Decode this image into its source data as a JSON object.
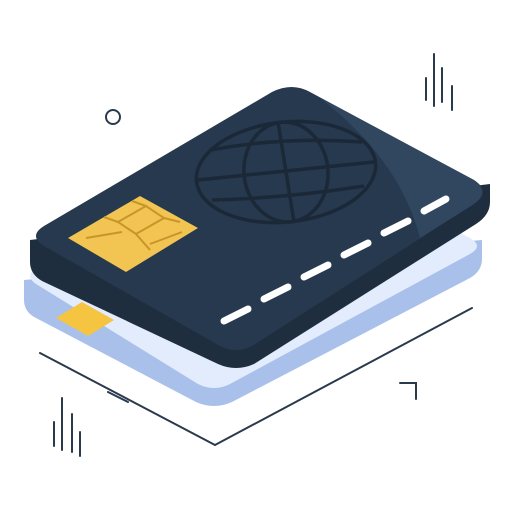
{
  "illustration": {
    "subject": "credit-card-stack",
    "card_count": 2,
    "colors": {
      "front_card_face": "#27394e",
      "front_card_side": "#1f2e3e",
      "front_card_highlight": "#344d66",
      "globe_stroke": "#1b2837",
      "chip": "#f2c452",
      "chip_lines": "#c8952a",
      "magstripe_dashes": "#ffffff",
      "back_card_face": "#e3ecfc",
      "back_card_side": "#a9c0ea",
      "back_card_strip": "#f5c542",
      "outline": "#2a3a4d"
    },
    "icons": [
      "globe-icon",
      "chip-icon",
      "circle-decoration",
      "sparkle-lines"
    ]
  }
}
